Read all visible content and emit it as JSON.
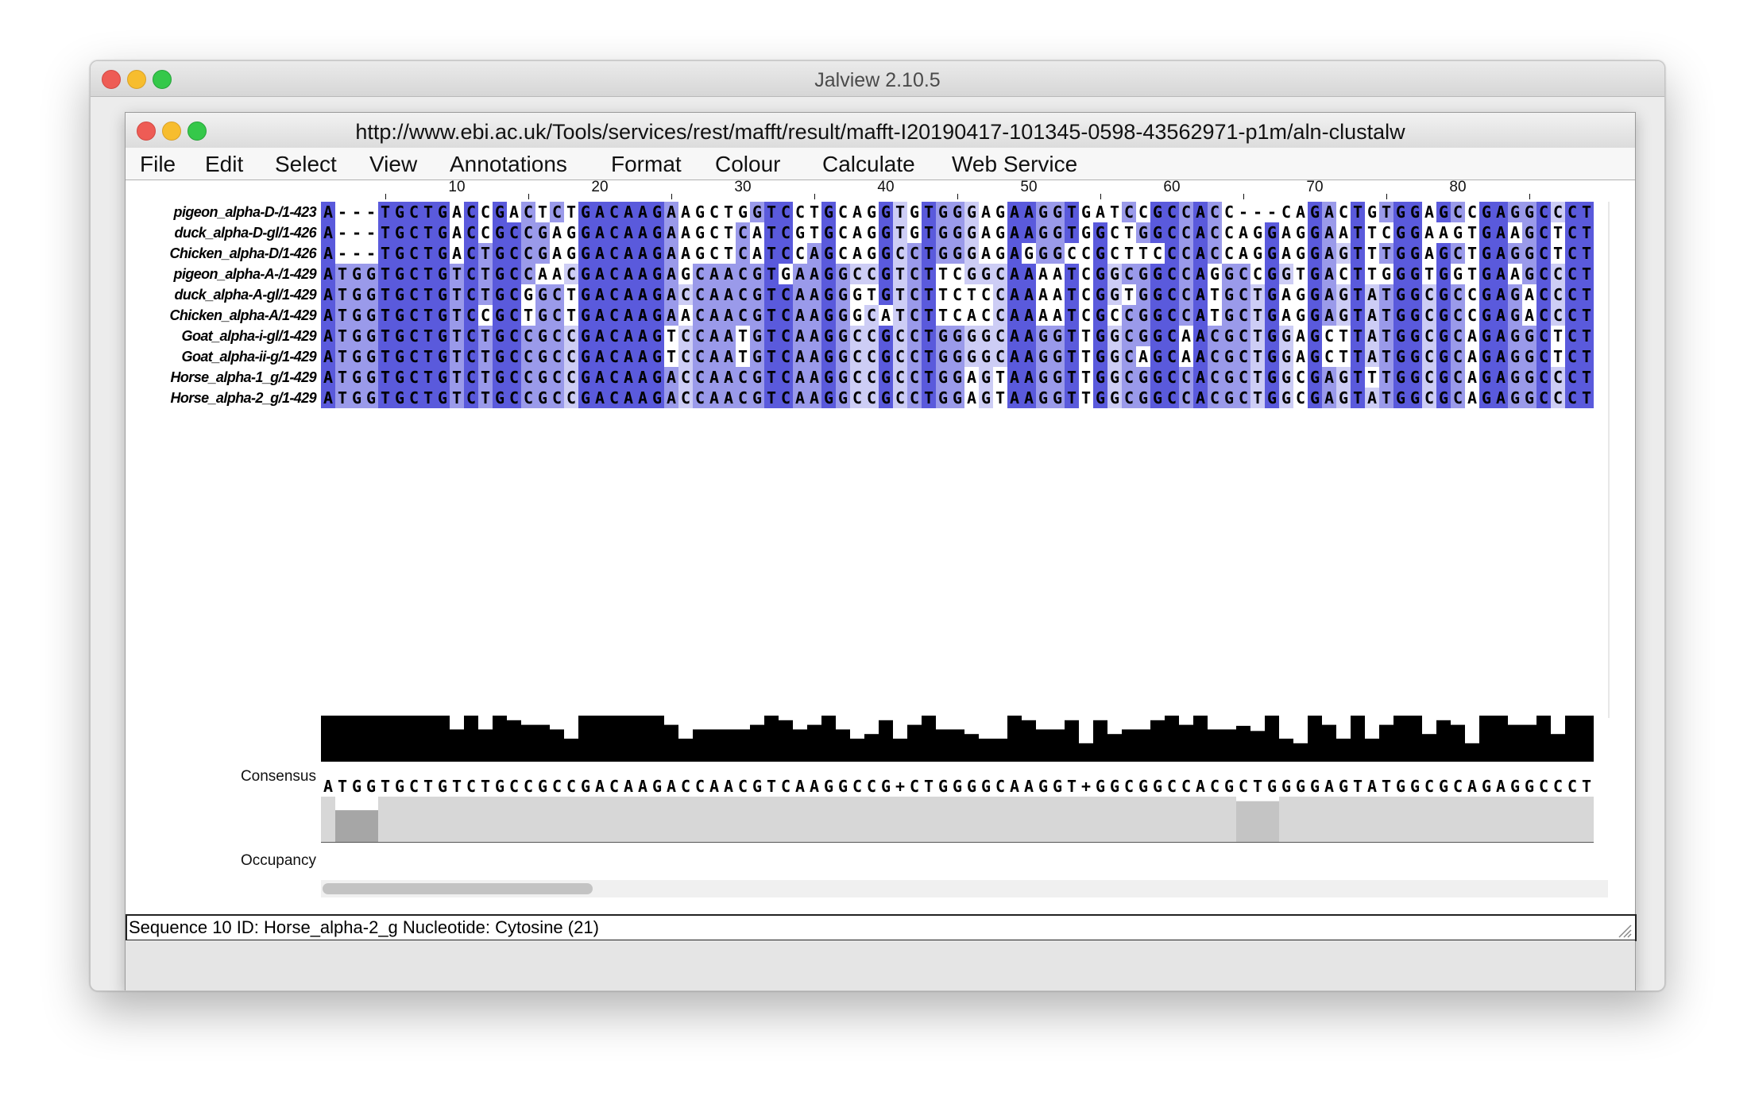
{
  "app": {
    "window_title": "Jalview 2.10.5"
  },
  "frame": {
    "title": "http://www.ebi.ac.uk/Tools/services/rest/mafft/result/mafft-I20190417-101345-0598-43562971-p1m/aln-clustalw"
  },
  "menu": [
    "File",
    "Edit",
    "Select",
    "View",
    "Annotations",
    "Format",
    "Colour",
    "Calculate",
    "Web Service"
  ],
  "ruler": {
    "labels": [
      "10",
      "20",
      "30",
      "40",
      "50",
      "60",
      "70",
      "80"
    ]
  },
  "sequences": [
    {
      "name": "pigeon_alpha-D-/1-423",
      "seq": "A---TGCTGACCGACTCTGACAAGAAGCTGGTCCTGCAGGTGTGGGAGAAGGTGATCCGCCACC---CAGACTGTGGAGCCGAGGCCCT"
    },
    {
      "name": "duck_alpha-D-gl/1-426",
      "seq": "A---TGCTGACCGCCGAGGACAAGAAGCTCATCGTGCAGGTGTGGGAGAAGGTGGCTGGCCACCAGGAGGAATTCGGAAGTGAAGCTCT"
    },
    {
      "name": "Chicken_alpha-D/1-426",
      "seq": "A---TGCTGACTGCCGAGGACAAGAAGCTCATCCAGCAGGCCTGGGAGAGGGCCGCTTCCCACCAGGAGGAGTTTGGAGCTGAGGCTCT"
    },
    {
      "name": "pigeon_alpha-A-/1-429",
      "seq": "ATGGTGCTGTCTGCCAACGACAAGAGCAACGTGAAGGCCGTCTTCGGCAAAATCGGCGGCCAGGCCGGTGACTTGGGTGGTGAAGCCCT"
    },
    {
      "name": "duck_alpha-A-gl/1-429",
      "seq": "ATGGTGCTGTCTGCGGCTGACAAGACCAACGTCAAGGGTGTCTTCTCCAAAATCGGTGGCCATGCTGAGGAGTATGGCGCCGAGACCCT"
    },
    {
      "name": "Chicken_alpha-A/1-429",
      "seq": "ATGGTGCTGTCCGCTGCTGACAAGAACAACGTCAAGGGCATCTTCACCAAAATCGCCGGCCATGCTGAGGAGTATGGCGCCGAGACCCT"
    },
    {
      "name": "Goat_alpha-i-gl/1-429",
      "seq": "ATGGTGCTGTCTGCCGCCGACAAGTCCAATGTCAAGGCCGCCTGGGGCAAGGTTGGCGGCAACGCTGGAGCTTATGGCGCAGAGGCTCT"
    },
    {
      "name": "Goat_alpha-ii-g/1-429",
      "seq": "ATGGTGCTGTCTGCCGCCGACAAGTCCAATGTCAAGGCCGCCTGGGGCAAGGTTGGCAGCAACGCTGGAGCTTATGGCGCAGAGGCTCT"
    },
    {
      "name": "Horse_alpha-1_g/1-429",
      "seq": "ATGGTGCTGTCTGCCGCCGACAAGACCAACGTCAAGGCCGCCTGGAGTAAGGTTGGCGGCCACGCTGGCGAGTTTGGCGCAGAGGCCCT"
    },
    {
      "name": "Horse_alpha-2_g/1-429",
      "seq": "ATGGTGCTGTCTGCCGCCGACAAGACCAACGTCAAGGCCGCCTGGAGTAAGGTTGGCGGCCACGCTGGCGAGTATGGCGCAGAGGCCCT"
    }
  ],
  "annotations": {
    "consensus_label": "Consensus",
    "occupancy_label": "Occupancy",
    "consensus_sequence": "ATGGTGCTGTCTGCCGCCGACAAGACCAACGTCAAGGCCG+CTGGGGCAAGGT+GGCGGCCACGCTGGGGAGTATGGCGCAGAGGCCCT"
  },
  "status": {
    "text": "Sequence 10 ID: Horse_alpha-2_g Nucleotide: Cytosine (21)"
  },
  "colors": {
    "pid_high": "#5a5adc",
    "pid_mid": "#9a9aea",
    "pid_low": "#cdcdf5",
    "consensus_bar": "#000000",
    "occupancy_full": "#d7d7d7",
    "occupancy_gap": "#a6a6a6"
  }
}
